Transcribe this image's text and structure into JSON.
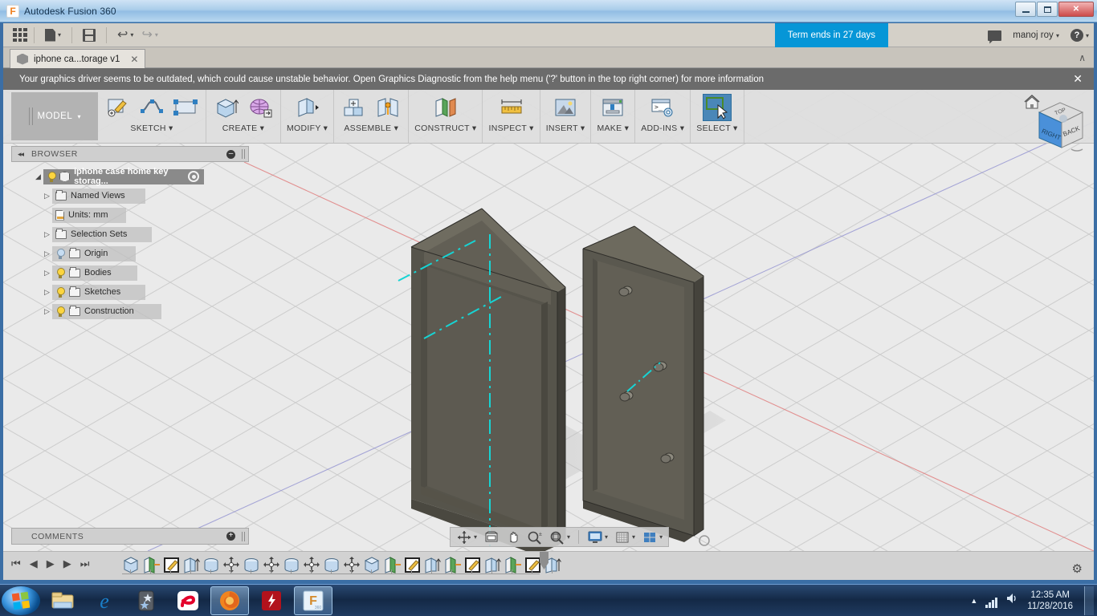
{
  "window": {
    "title": "Autodesk Fusion 360",
    "app_icon": "fusion-f-icon",
    "buttons": {
      "minimize": "minimize-icon",
      "maximize": "maximize-icon",
      "close": "close-icon"
    }
  },
  "app_toolbar": {
    "show_data_panel": "grid-9-dots-icon",
    "file_label": "file-icon",
    "save_label": "save-icon",
    "undo_label": "undo-icon",
    "redo_label": "redo-icon",
    "term_badge": "Term ends in 27 days",
    "chat_icon": "chat-icon",
    "user_name": "manoj roy",
    "help_icon": "?"
  },
  "tabs": {
    "documents": [
      {
        "label": "iphone ca...torage v1",
        "icon": "document-cube-icon",
        "close": "✕",
        "active": true
      }
    ],
    "collapse_chevron": "∧"
  },
  "banner": {
    "text": "Your graphics driver seems to be outdated, which could cause unstable behavior. Open Graphics Diagnostic from the help menu ('?' button in the top right corner) for more information",
    "close": "✕",
    "bg": "#6b6b6b"
  },
  "ribbon": {
    "workspace": "MODEL",
    "workspace_caret": "▾",
    "groups": [
      {
        "label": "SKETCH",
        "caret": "▾",
        "items": [
          "create-sketch-icon",
          "spline-icon",
          "rectangle-icon"
        ]
      },
      {
        "label": "CREATE",
        "caret": "▾",
        "items": [
          "extrude-icon",
          "sculpt-form-icon"
        ]
      },
      {
        "label": "MODIFY",
        "caret": "▾",
        "items": [
          "press-pull-icon"
        ]
      },
      {
        "label": "ASSEMBLE",
        "caret": "▾",
        "items": [
          "new-component-icon",
          "joint-icon"
        ]
      },
      {
        "label": "CONSTRUCT",
        "caret": "▾",
        "items": [
          "offset-plane-icon"
        ]
      },
      {
        "label": "INSPECT",
        "caret": "▾",
        "items": [
          "measure-icon"
        ]
      },
      {
        "label": "INSERT",
        "caret": "▾",
        "items": [
          "insert-image-icon"
        ]
      },
      {
        "label": "MAKE",
        "caret": "▾",
        "items": [
          "3d-print-icon"
        ]
      },
      {
        "label": "ADD-INS",
        "caret": "▾",
        "items": [
          "scripts-addins-icon"
        ]
      },
      {
        "label": "SELECT",
        "caret": "▾",
        "items": [
          "select-window-icon"
        ],
        "active": true
      }
    ]
  },
  "browser": {
    "title": "BROWSER",
    "collapse_icon": "◂◂",
    "minus_icon": "–",
    "tree": [
      {
        "label": "iphone case home key storag...",
        "icon": "component-cube-icon",
        "bulb": "on",
        "arrow": "◢",
        "root": true,
        "trailing": "target-icon"
      },
      {
        "label": "Named Views",
        "icon": "folder-icon",
        "bulb": "none",
        "arrow": "▷"
      },
      {
        "label": "Units: mm",
        "icon": "units-page-icon",
        "bulb": "none",
        "arrow": ""
      },
      {
        "label": "Selection Sets",
        "icon": "folder-icon",
        "bulb": "none",
        "arrow": "▷"
      },
      {
        "label": "Origin",
        "icon": "folder-icon",
        "bulb": "dim",
        "arrow": "▷"
      },
      {
        "label": "Bodies",
        "icon": "folder-icon",
        "bulb": "on",
        "arrow": "▷"
      },
      {
        "label": "Sketches",
        "icon": "folder-icon",
        "bulb": "on",
        "arrow": "▷"
      },
      {
        "label": "Construction",
        "icon": "folder-icon",
        "bulb": "on",
        "arrow": "▷"
      }
    ]
  },
  "comments": {
    "title": "COMMENTS",
    "plus_icon": "+"
  },
  "viewcube": {
    "home_icon": "home-icon",
    "faces": {
      "front": "RIGHT",
      "right": "BACK",
      "top": "TOP"
    },
    "highlighted_face": "RIGHT",
    "arc_icon": "◡"
  },
  "navbar": {
    "items": [
      {
        "name": "orbit-icon",
        "caret": "▾"
      },
      {
        "name": "look-at-icon",
        "caret": ""
      },
      {
        "name": "pan-icon",
        "caret": ""
      },
      {
        "name": "zoom-icon",
        "caret": ""
      },
      {
        "name": "fit-icon",
        "caret": "▾"
      },
      {
        "name": "display-settings-icon",
        "caret": "▾"
      },
      {
        "name": "grid-snaps-icon",
        "caret": "▾"
      },
      {
        "name": "viewports-icon",
        "caret": "▾"
      }
    ]
  },
  "timeline": {
    "playback": [
      "◀❘",
      "◀",
      "▶",
      "▶",
      "❘▶"
    ],
    "features": [
      "extrude-icon",
      "plane-icon",
      "sketch-icon",
      "extrude-up-icon",
      "cylinder-icon",
      "move-icon",
      "cylinder-icon",
      "move-icon",
      "cylinder-icon",
      "move-icon",
      "cylinder-icon",
      "move-icon",
      "extrude-icon",
      "plane-icon",
      "sketch-icon",
      "extrude-up-icon",
      "plane-icon",
      "sketch-icon",
      "extrude-up-icon",
      "plane-icon",
      "sketch-icon",
      "extrude-up-icon"
    ],
    "settings_icon": "gear-icon"
  },
  "model": {
    "body_color": "#5c5a50",
    "body_top_color": "#6e6b5f",
    "body_side_color": "#4b4942",
    "axis_color": "#16d4d4",
    "x_axis_color": "#e06c6c",
    "y_axis_color": "#7a7ad4",
    "grid_color": "#cfcfcf",
    "background": "#eaeaea"
  },
  "taskbar": {
    "start": "windows-start-icon",
    "items": [
      {
        "name": "windows-explorer-icon",
        "running": false
      },
      {
        "name": "internet-explorer-icon",
        "running": false
      },
      {
        "name": "stars-app-icon",
        "running": false
      },
      {
        "name": "airtel-icon",
        "running": false
      },
      {
        "name": "firefox-icon",
        "running": true
      },
      {
        "name": "flash-player-icon",
        "running": false
      },
      {
        "name": "fusion-360-icon",
        "running": true
      }
    ],
    "tray": {
      "show_hidden": "▲",
      "network_icon": "network-signal-icon",
      "volume_icon": "volume-icon",
      "time": "12:35 AM",
      "date": "11/28/2016"
    }
  }
}
